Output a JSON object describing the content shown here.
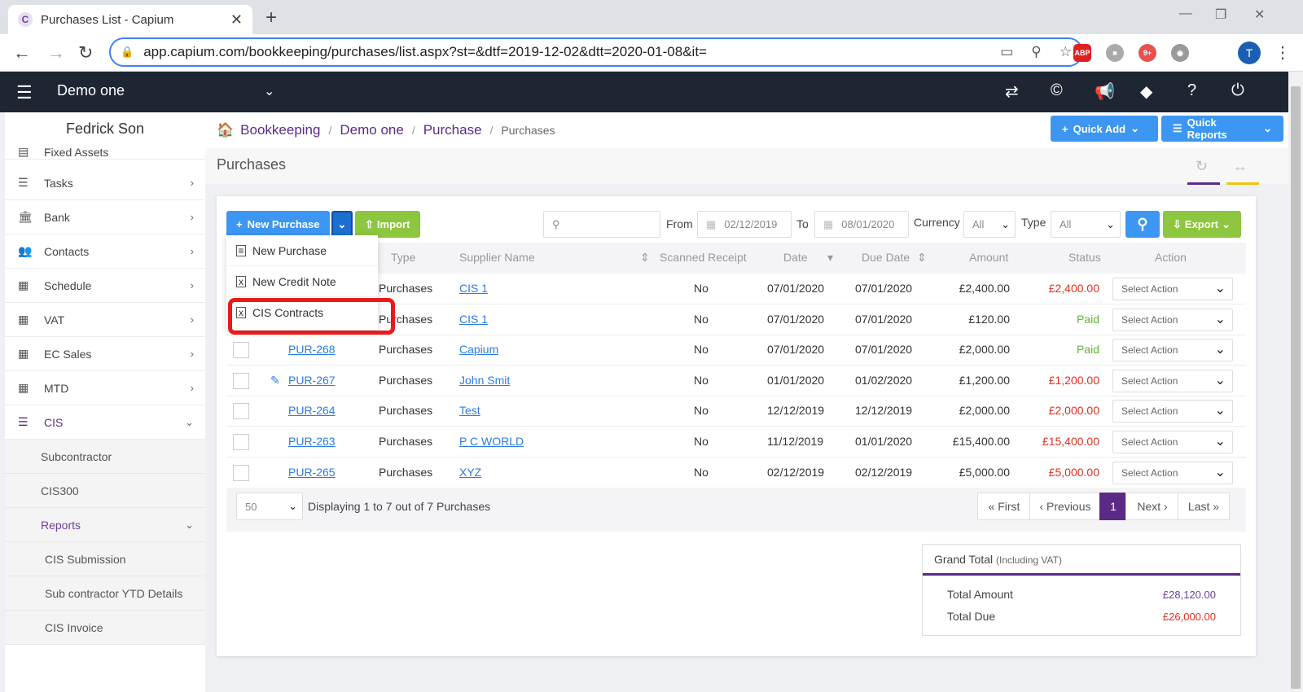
{
  "browser": {
    "tab_title": "Purchases List - Capium",
    "favicon": "C",
    "url": "app.capium.com/bookkeeping/purchases/list.aspx?st=&dtf=2019-12-02&dtt=2020-01-08&it=",
    "profile_initial": "T",
    "ext_abp": "ABP",
    "ext_badge": "9+"
  },
  "appbar": {
    "company": "Demo one"
  },
  "sidebar": {
    "user": "Fedrick Son",
    "items": [
      {
        "label": "Fixed Assets",
        "icon": "fixed-assets-icon"
      },
      {
        "label": "Tasks",
        "icon": "tasks-icon"
      },
      {
        "label": "Bank",
        "icon": "bank-icon"
      },
      {
        "label": "Contacts",
        "icon": "contacts-icon"
      },
      {
        "label": "Schedule",
        "icon": "calendar-icon"
      },
      {
        "label": "VAT",
        "icon": "calculator-icon"
      },
      {
        "label": "EC Sales",
        "icon": "calculator-icon"
      },
      {
        "label": "MTD",
        "icon": "calendar-icon"
      },
      {
        "label": "CIS",
        "icon": "list-icon"
      }
    ],
    "cis_sub": [
      "Subcontractor",
      "CIS300",
      "Reports"
    ],
    "reports_sub": [
      "CIS Submission",
      "Sub contractor YTD Details",
      "CIS Invoice"
    ]
  },
  "breadcrumb": {
    "home": "Bookkeeping",
    "company": "Demo one",
    "section": "Purchase",
    "current": "Purchases"
  },
  "top_buttons": {
    "quick_add": "Quick Add",
    "quick_reports": "Quick Reports"
  },
  "page_title": "Purchases",
  "toolbar": {
    "new_purchase": "New Purchase",
    "import": "Import",
    "from_label": "From",
    "from_date": "02/12/2019",
    "to_label": "To",
    "to_date": "08/01/2020",
    "currency_label": "Currency",
    "currency_value": "All",
    "type_label": "Type",
    "type_value": "All",
    "export": "Export"
  },
  "dropdown": [
    "New Purchase",
    "New Credit Note",
    "CIS Contracts"
  ],
  "table": {
    "headers": [
      "Type",
      "Supplier Name",
      "Scanned Receipt",
      "Date",
      "Due Date",
      "Amount",
      "Status",
      "Action"
    ],
    "rows": [
      {
        "ref": "",
        "type": "Purchases",
        "supplier": "CIS 1",
        "scanned": "No",
        "date": "07/01/2020",
        "due": "07/01/2020",
        "amount": "£2,400.00",
        "status": "£2,400.00",
        "status_kind": "due",
        "action": "Select Action"
      },
      {
        "ref": "",
        "type": "Purchases",
        "supplier": "CIS 1",
        "scanned": "No",
        "date": "07/01/2020",
        "due": "07/01/2020",
        "amount": "£120.00",
        "status": "Paid",
        "status_kind": "paid",
        "action": "Select Action"
      },
      {
        "ref": "PUR-268",
        "type": "Purchases",
        "supplier": "Capium",
        "scanned": "No",
        "date": "07/01/2020",
        "due": "07/01/2020",
        "amount": "£2,000.00",
        "status": "Paid",
        "status_kind": "paid",
        "action": "Select Action"
      },
      {
        "ref": "PUR-267",
        "type": "Purchases",
        "supplier": "John Smit",
        "scanned": "No",
        "date": "01/01/2020",
        "due": "01/02/2020",
        "amount": "£1,200.00",
        "status": "£1,200.00",
        "status_kind": "due",
        "action": "Select Action",
        "attachment": true
      },
      {
        "ref": "PUR-264",
        "type": "Purchases",
        "supplier": "Test",
        "scanned": "No",
        "date": "12/12/2019",
        "due": "12/12/2019",
        "amount": "£2,000.00",
        "status": "£2,000.00",
        "status_kind": "due",
        "action": "Select Action"
      },
      {
        "ref": "PUR-263",
        "type": "Purchases",
        "supplier": "P C WORLD",
        "scanned": "No",
        "date": "11/12/2019",
        "due": "01/01/2020",
        "amount": "£15,400.00",
        "status": "£15,400.00",
        "status_kind": "due",
        "action": "Select Action"
      },
      {
        "ref": "PUR-265",
        "type": "Purchases",
        "supplier": "XYZ",
        "scanned": "No",
        "date": "02/12/2019",
        "due": "02/12/2019",
        "amount": "£5,000.00",
        "status": "£5,000.00",
        "status_kind": "due",
        "action": "Select Action"
      }
    ]
  },
  "pagination": {
    "page_size": "50",
    "info": "Displaying 1 to 7 out of 7 Purchases",
    "first": "« First",
    "previous": "‹ Previous",
    "current": "1",
    "next": "Next ›",
    "last": "Last »"
  },
  "totals": {
    "heading": "Grand Total",
    "heading_note": "(Including VAT)",
    "total_amount_label": "Total Amount",
    "total_amount": "£28,120.00",
    "total_due_label": "Total Due",
    "total_due": "£26,000.00"
  },
  "colors": {
    "brand_purple": "#5b2a86",
    "primary_blue": "#3d96f2",
    "green": "#8dc63f",
    "due_red": "#e0301e",
    "paid_green": "#5fb634"
  }
}
